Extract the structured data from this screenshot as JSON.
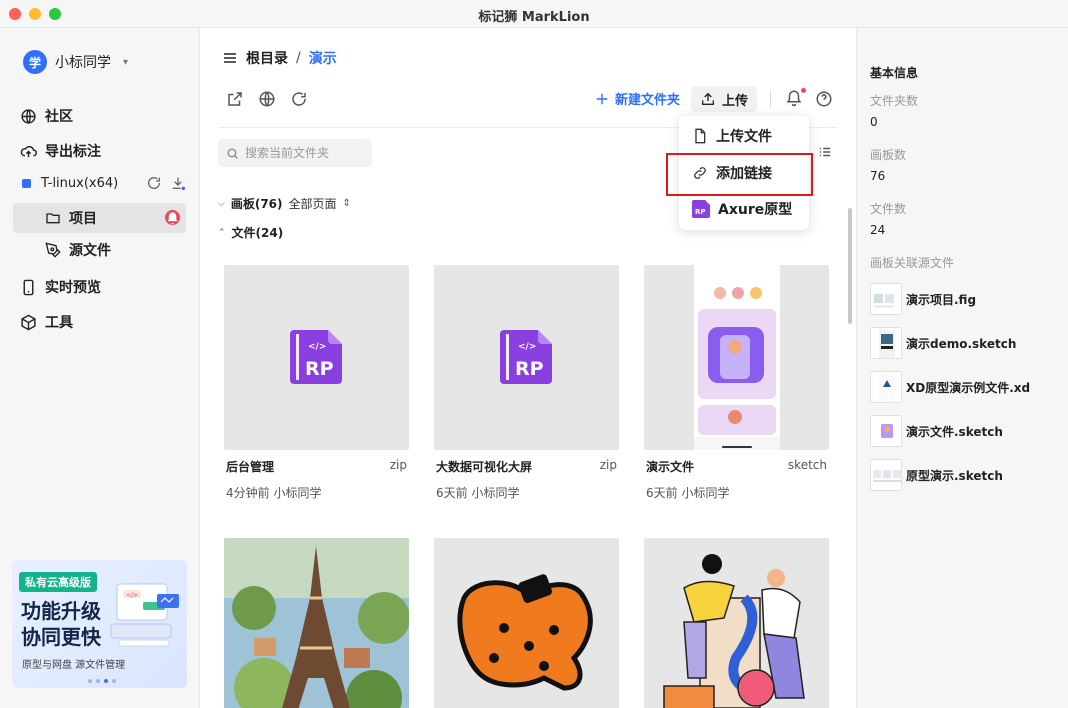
{
  "window": {
    "title": "标记狮 MarkLion"
  },
  "user": {
    "avatar_text": "学",
    "name": "小标同学"
  },
  "sidebar": {
    "community": "社区",
    "export": "导出标注",
    "team": "T-linux(x64)",
    "project": "项目",
    "source": "源文件",
    "preview": "实时预览",
    "tools": "工具"
  },
  "promo": {
    "tag": "私有云高级版",
    "line1": "功能升级",
    "line2": "协同更快",
    "sub": "原型与网盘   源文件管理"
  },
  "breadcrumb": {
    "root": "根目录",
    "sep": "/",
    "current": "演示"
  },
  "toolbar": {
    "new_folder": "新建文件夹",
    "upload": "上传"
  },
  "search": {
    "placeholder": "搜索当前文件夹"
  },
  "sections": {
    "boards_title": "画板(76)",
    "boards_filter": "全部页面",
    "files_title": "文件(24)"
  },
  "files": [
    {
      "name": "后台管理",
      "ext": "zip",
      "meta": "4分钟前 小标同学",
      "icon_text": "RP"
    },
    {
      "name": "大数据可视化大屏",
      "ext": "zip",
      "meta": "6天前 小标同学",
      "icon_text": "RP"
    },
    {
      "name": "演示文件",
      "ext": "sketch",
      "meta": "6天前 小标同学"
    }
  ],
  "dropdown": {
    "upload_file": "上传文件",
    "add_link": "添加链接",
    "axure": "Axure原型",
    "axure_icon_text": "RP"
  },
  "info": {
    "title": "基本信息",
    "folder_count_label": "文件夹数",
    "folder_count": "0",
    "board_count_label": "画板数",
    "board_count": "76",
    "file_count_label": "文件数",
    "file_count": "24",
    "linked_label": "画板关联源文件",
    "linked": [
      {
        "name": "演示项目.fig"
      },
      {
        "name": "演示demo.sketch"
      },
      {
        "name": "XD原型演示例文件.xd"
      },
      {
        "name": "演示文件.sketch"
      },
      {
        "name": "原型演示.sketch"
      }
    ]
  },
  "colors": {
    "accent": "#2f6fff",
    "axure": "#8a3fe0",
    "alert": "#f0465a",
    "highlight_border": "#e0181b"
  }
}
